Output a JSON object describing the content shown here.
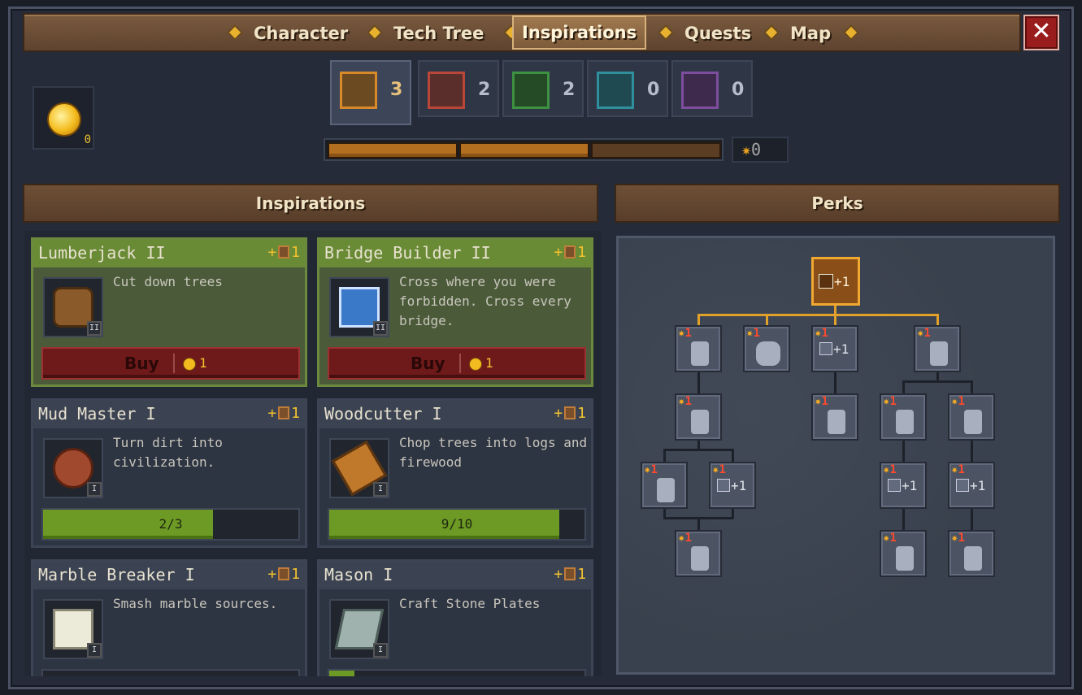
{
  "nav": {
    "tabs": [
      {
        "label": "Character",
        "active": false
      },
      {
        "label": "Tech Tree",
        "active": false
      },
      {
        "label": "Inspirations",
        "active": true
      },
      {
        "label": "Quests",
        "active": false
      },
      {
        "label": "Map",
        "active": false
      }
    ],
    "close_label": "✕"
  },
  "currency": {
    "amount": "0",
    "icon": "gold-swirl-coin-icon"
  },
  "categories": [
    {
      "icon": "hammer-icon",
      "count": "3",
      "active": true,
      "color": "#d8892a"
    },
    {
      "icon": "gear-icon",
      "count": "2",
      "active": false,
      "color": "#b8473a"
    },
    {
      "icon": "wheat-icon",
      "count": "2",
      "active": false,
      "color": "#3d9140"
    },
    {
      "icon": "book-icon",
      "count": "0",
      "active": false,
      "color": "#2f8f9c"
    },
    {
      "icon": "skull-icon",
      "count": "0",
      "active": false,
      "color": "#7d4d9e"
    }
  ],
  "progress": {
    "segments_total": 3,
    "segments_filled": 2
  },
  "points": {
    "star": "✷",
    "value": "0"
  },
  "inspirations_header": "Inspirations",
  "perks_header": "Perks",
  "cards": [
    {
      "title": "Lumberjack II",
      "bonus": "1",
      "desc": "Cut down trees",
      "level": "II",
      "icon": "log-icon",
      "state": "buy",
      "buy_label": "Buy",
      "price": "1"
    },
    {
      "title": "Bridge Builder II",
      "bonus": "1",
      "desc": "Cross where you were forbidden. Cross every bridge.",
      "level": "II",
      "icon": "bridge-blueprint-icon",
      "state": "buy",
      "buy_label": "Buy",
      "price": "1"
    },
    {
      "title": "Mud Master I",
      "bonus": "1",
      "desc": "Turn dirt into civilization.",
      "level": "I",
      "icon": "clay-disc-icon",
      "state": "progress",
      "progress_text": "2/3",
      "progress": 0.6667
    },
    {
      "title": "Woodcutter I",
      "bonus": "1",
      "desc": "Chop trees into logs and firewood",
      "level": "I",
      "icon": "firewood-icon",
      "state": "progress",
      "progress_text": "9/10",
      "progress": 0.9
    },
    {
      "title": "Marble Breaker I",
      "bonus": "1",
      "desc": "Smash marble sources.",
      "level": "I",
      "icon": "marble-icon",
      "state": "progress",
      "progress_text": "",
      "progress": 0.0
    },
    {
      "title": "Mason I",
      "bonus": "1",
      "desc": "Craft Stone Plates",
      "level": "I",
      "icon": "stone-plate-icon",
      "state": "progress",
      "progress_text": "",
      "progress": 0.1
    }
  ],
  "perk_root": {
    "label": "+1"
  },
  "perk_nodes": [
    {
      "cost": "1",
      "kind": "worker"
    },
    {
      "cost": "1",
      "kind": "stack"
    },
    {
      "cost": "1",
      "kind": "plus",
      "label": "+1"
    },
    {
      "cost": "1",
      "kind": "worker"
    },
    {
      "cost": "1",
      "kind": "worker"
    },
    {
      "cost": "1",
      "kind": "worker"
    },
    {
      "cost": "1",
      "kind": "worker"
    },
    {
      "cost": "1",
      "kind": "worker"
    },
    {
      "cost": "1",
      "kind": "worker"
    },
    {
      "cost": "1",
      "kind": "plus",
      "label": "+1"
    },
    {
      "cost": "1",
      "kind": "plus",
      "label": "+1"
    },
    {
      "cost": "1",
      "kind": "plus",
      "label": "+1"
    },
    {
      "cost": "1",
      "kind": "worker"
    },
    {
      "cost": "1",
      "kind": "worker"
    },
    {
      "cost": "1",
      "kind": "worker"
    }
  ]
}
